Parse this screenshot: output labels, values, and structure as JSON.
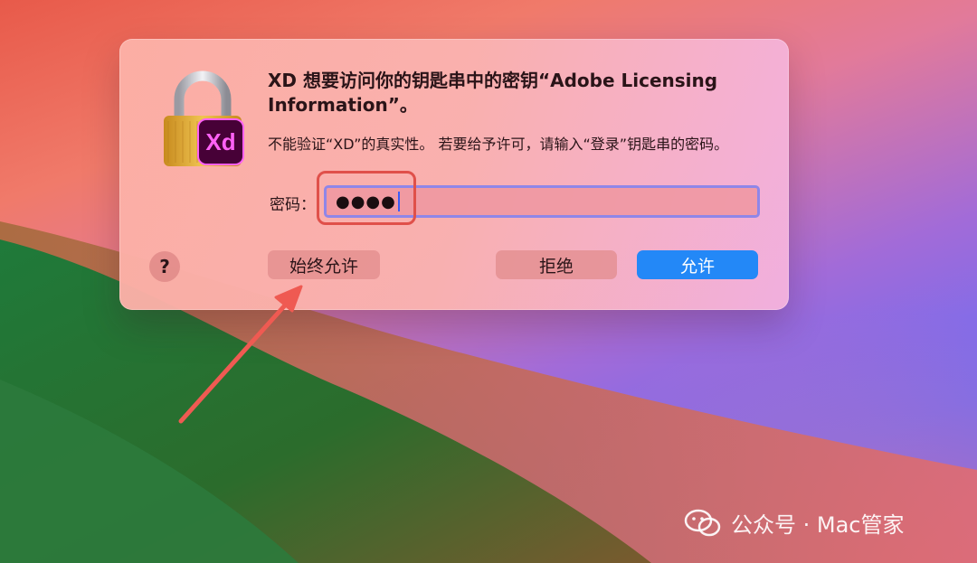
{
  "dialog": {
    "title": "XD 想要访问你的钥匙串中的密钥“Adobe Licensing Information”。",
    "message": "不能验证“XD”的真实性。 若要给予许可，请输入“登录”钥匙串的密码。",
    "app_badge": "Xd",
    "password_label": "密码：",
    "password_value": "●●●●",
    "help_label": "?",
    "buttons": {
      "always_allow": "始终允许",
      "deny": "拒绝",
      "allow": "允许"
    }
  },
  "watermark": {
    "text": "公众号 · Mac管家"
  },
  "colors": {
    "allow_button": "#2388f7",
    "highlight": "#e0504a",
    "xd_badge_bg": "#470137",
    "xd_badge_text": "#ff61f6"
  },
  "icons": [
    "keychain-lock-icon",
    "xd-app-icon",
    "wechat-icon",
    "arrow-annotation"
  ]
}
